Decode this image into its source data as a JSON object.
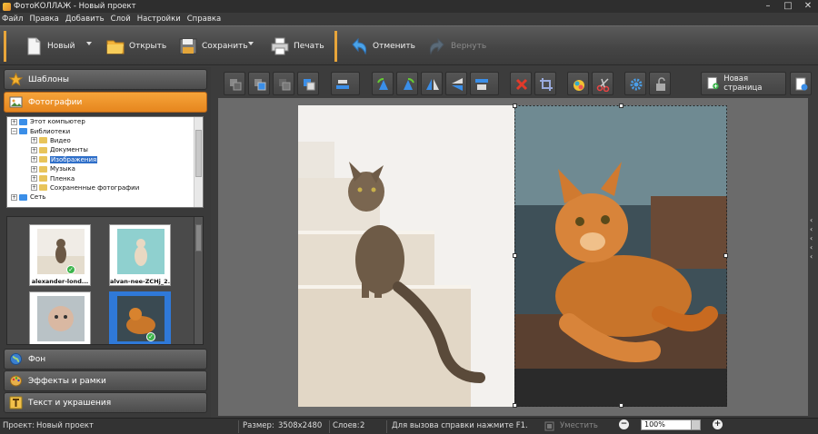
{
  "window": {
    "title": "ФотоКОЛЛАЖ - Новый проект",
    "min": "–",
    "max": "□",
    "close": "✕"
  },
  "menu": [
    "Файл",
    "Правка",
    "Добавить",
    "Слой",
    "Настройки",
    "Справка"
  ],
  "toolbar": {
    "new_label": "Новый",
    "open_label": "Открыть",
    "save_label": "Сохранить",
    "print_label": "Печать",
    "undo_label": "Отменить",
    "redo_label": "Вернуть"
  },
  "sidebar": {
    "templates": "Шаблоны",
    "photos": "Фотографии",
    "background": "Фон",
    "effects": "Эффекты и рамки",
    "text": "Текст и украшения"
  },
  "tree": [
    {
      "label": "Этот компьютер",
      "indent": 1,
      "exp": "+"
    },
    {
      "label": "Библиотеки",
      "indent": 1,
      "exp": "−"
    },
    {
      "label": "Видео",
      "indent": 2,
      "exp": "+"
    },
    {
      "label": "Документы",
      "indent": 2,
      "exp": "+"
    },
    {
      "label": "Изображения",
      "indent": 2,
      "exp": "+",
      "selected": true
    },
    {
      "label": "Музыка",
      "indent": 2,
      "exp": "+"
    },
    {
      "label": "Пленка",
      "indent": 2,
      "exp": "+"
    },
    {
      "label": "Сохраненные фотографии",
      "indent": 2,
      "exp": "+"
    },
    {
      "label": "Сеть",
      "indent": 1,
      "exp": "+"
    }
  ],
  "thumbnails": [
    {
      "caption": "alexander-lond...",
      "checked": true,
      "selected": false
    },
    {
      "caption": "alvan-nee-ZCHj_2...",
      "checked": false,
      "selected": false
    },
    {
      "caption": "",
      "checked": false,
      "selected": false
    },
    {
      "caption": "",
      "checked": true,
      "selected": true
    }
  ],
  "editor": {
    "new_page_label": "Новая страница"
  },
  "status": {
    "project_label": "Проект:",
    "project_name": "Новый проект",
    "size_label": "Размер:",
    "size_value": "3508x2480",
    "layers_label": "Слоев:",
    "layers_value": "2",
    "help_hint": "Для вызова справки нажмите F1.",
    "fit_label": "Уместить",
    "zoom_value": "100%",
    "zoom_out": "−",
    "zoom_in": "+"
  },
  "colors": {
    "accent": "#e8952a",
    "selection": "#2f6fc9"
  }
}
